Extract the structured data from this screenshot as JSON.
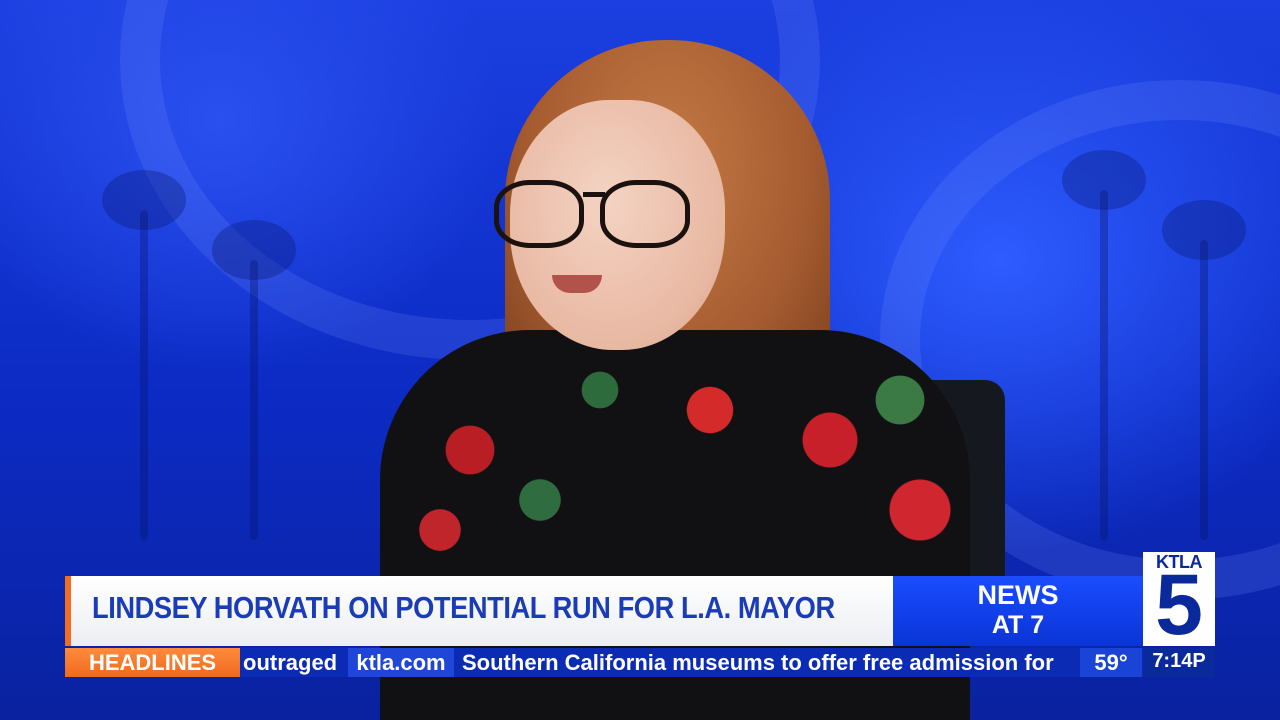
{
  "lower_third": {
    "headline": "LINDSEY HORVATH ON POTENTIAL RUN FOR L.A. MAYOR"
  },
  "program": {
    "line1": "NEWS",
    "line2": "AT 7"
  },
  "station_logo": {
    "callsign": "KTLA",
    "channel": "5"
  },
  "ticker": {
    "label": "HEADLINES",
    "previous_fragment": "outraged",
    "site": "ktla.com",
    "story": "Southern California museums to offer free admission for",
    "temperature": "59°",
    "time": "7:14P"
  },
  "colors": {
    "brand_blue": "#0b2bb5",
    "accent_orange": "#f26d22",
    "headline_blue": "#1a3cb8"
  }
}
